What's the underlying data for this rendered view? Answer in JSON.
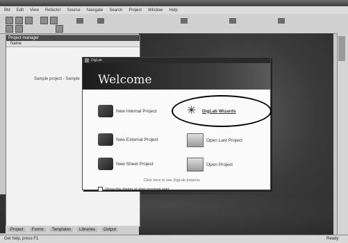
{
  "menu": [
    "Bld",
    "Edit",
    "View",
    "Refactor",
    "Source",
    "Navigate",
    "Search",
    "Project",
    "Window",
    "Help"
  ],
  "left_panel": {
    "title": "Project manager",
    "header": "Name",
    "item": "Sample project · Sample"
  },
  "dialog": {
    "title": "DigLab",
    "heading": "Welcome",
    "options": {
      "new_internal": "New Internal Project",
      "wizard": "DigLab Wizards",
      "new_external": "New External Project",
      "open_last": "Open Last Project",
      "new_sheet": "New Sheet Project",
      "open_project": "Open Project"
    },
    "link": "Click here to see DigLab projects",
    "checkbox": "Show this dialog at start program start"
  },
  "bottom_tabs": [
    "Project",
    "Forms",
    "Templates",
    "Libraries",
    "Output"
  ],
  "status": {
    "left": "Get help, press F1",
    "right": "Ready"
  }
}
